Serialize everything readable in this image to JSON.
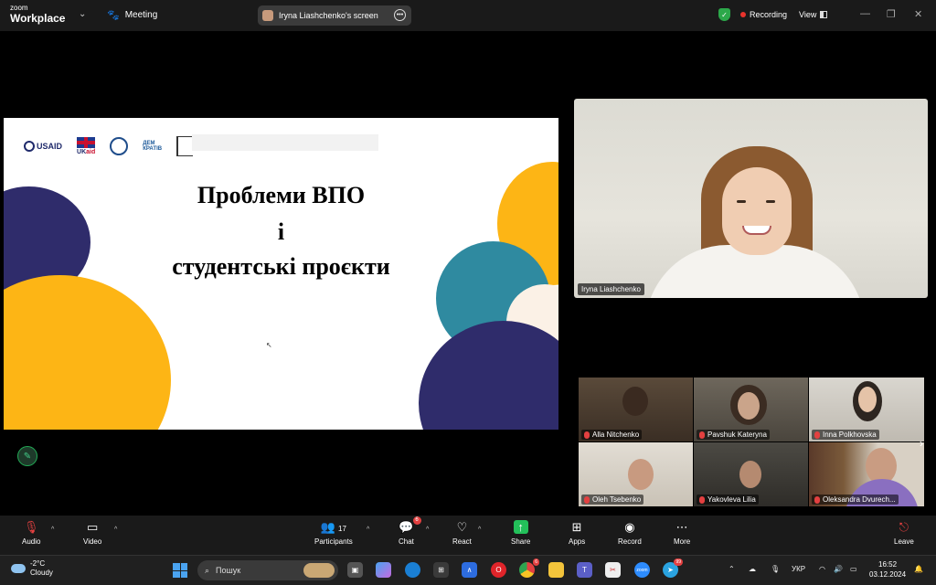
{
  "window": {
    "app_name_top": "zoom",
    "app_name_bottom": "Workplace",
    "meeting_label": "Meeting",
    "screen_share_label": "Iryna Liashchenko's screen",
    "recording_label": "Recording",
    "view_label": "View"
  },
  "slide": {
    "logos": {
      "usaid": "USAID",
      "ukaid_uk": "UK",
      "ukaid_aid": "aid",
      "dem_line1": "ДЕМ",
      "dem_line2": "КРАТІВ"
    },
    "title_line1": "Проблеми ВПО",
    "title_line2": "і",
    "title_line3": "студентські проєкти",
    "colors": {
      "navy": "#2f2c6b",
      "gold": "#fdb515",
      "teal": "#2f8aa0",
      "cream": "#fbf1e6"
    }
  },
  "speaker": {
    "name": "Iryna Liashchenko"
  },
  "gallery": {
    "participants": [
      {
        "name": "Alla Nitchenko"
      },
      {
        "name": "Pavshuk Kateryna"
      },
      {
        "name": "Inna Polkhovska"
      },
      {
        "name": "Oleh Tsebenko"
      },
      {
        "name": "Yakovleva Lilia"
      },
      {
        "name": "Oleksandra Dvurech..."
      }
    ]
  },
  "toolbar": {
    "audio": "Audio",
    "video": "Video",
    "participants": "Participants",
    "participants_count": "17",
    "chat": "Chat",
    "chat_badge": "6",
    "react": "React",
    "share": "Share",
    "apps": "Apps",
    "record": "Record",
    "more": "More",
    "leave": "Leave"
  },
  "taskbar": {
    "temperature": "-2°C",
    "weather": "Cloudy",
    "search_placeholder": "Пошук",
    "chrome_badge": "6",
    "telegram_badge": "99",
    "language": "УКР",
    "time": "16:52",
    "date": "03.12.2024"
  }
}
